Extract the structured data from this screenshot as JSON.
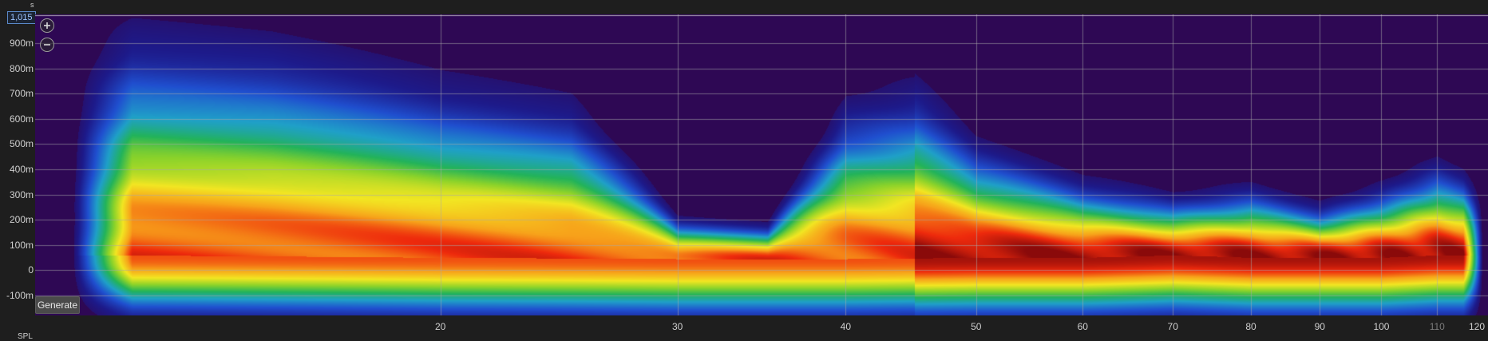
{
  "header": {
    "unit": "s",
    "readout": "1,015"
  },
  "controls": {
    "generate_label": "Generate"
  },
  "axis_unit": "SPL",
  "chart_data": {
    "type": "heatmap",
    "title": "",
    "xlabel": "",
    "ylabel": "",
    "x_scale": "log",
    "xlim": [
      10,
      120
    ],
    "ylim": [
      -0.18,
      1.015
    ],
    "y_tick_values": [
      0.9,
      0.8,
      0.7,
      0.6,
      0.5,
      0.4,
      0.3,
      0.2,
      0.1,
      0,
      -0.1
    ],
    "y_tick_labels": [
      "900m",
      "800m",
      "700m",
      "600m",
      "500m",
      "400m",
      "300m",
      "200m",
      "100m",
      "0",
      "-100m"
    ],
    "x_tick_values": [
      20,
      30,
      40,
      50,
      60,
      70,
      80,
      90,
      100,
      110,
      120
    ],
    "x_tick_labels": [
      "20",
      "30",
      "40",
      "50",
      "60",
      "70",
      "80",
      "90",
      "100",
      "110",
      "120"
    ],
    "x_tick_dim": [
      false,
      false,
      false,
      false,
      false,
      false,
      false,
      false,
      false,
      true,
      false
    ],
    "grid": true,
    "colorscale": [
      "#2e0854",
      "#1d1a8a",
      "#1f4fcf",
      "#1fa0c8",
      "#22b35a",
      "#8cd32a",
      "#f2e622",
      "#f7a21a",
      "#ee2a0c",
      "#8a0a0a"
    ],
    "background_color": "#2e0854",
    "ridge": {
      "freq": [
        11,
        20,
        30,
        40,
        50,
        60,
        70,
        80,
        90,
        100,
        110,
        118
      ],
      "time": [
        0.06,
        0.05,
        0.045,
        0.045,
        0.05,
        0.05,
        0.06,
        0.05,
        0.05,
        0.05,
        0.06,
        0.06
      ]
    },
    "decay_extent": {
      "freq": [
        11,
        15,
        20,
        25,
        30,
        35,
        40,
        45,
        50,
        60,
        70,
        80,
        90,
        100,
        110,
        118
      ],
      "time": [
        0.8,
        0.75,
        0.62,
        0.55,
        0.18,
        0.16,
        0.55,
        0.6,
        0.42,
        0.3,
        0.25,
        0.28,
        0.22,
        0.28,
        0.36,
        0.3
      ]
    }
  }
}
